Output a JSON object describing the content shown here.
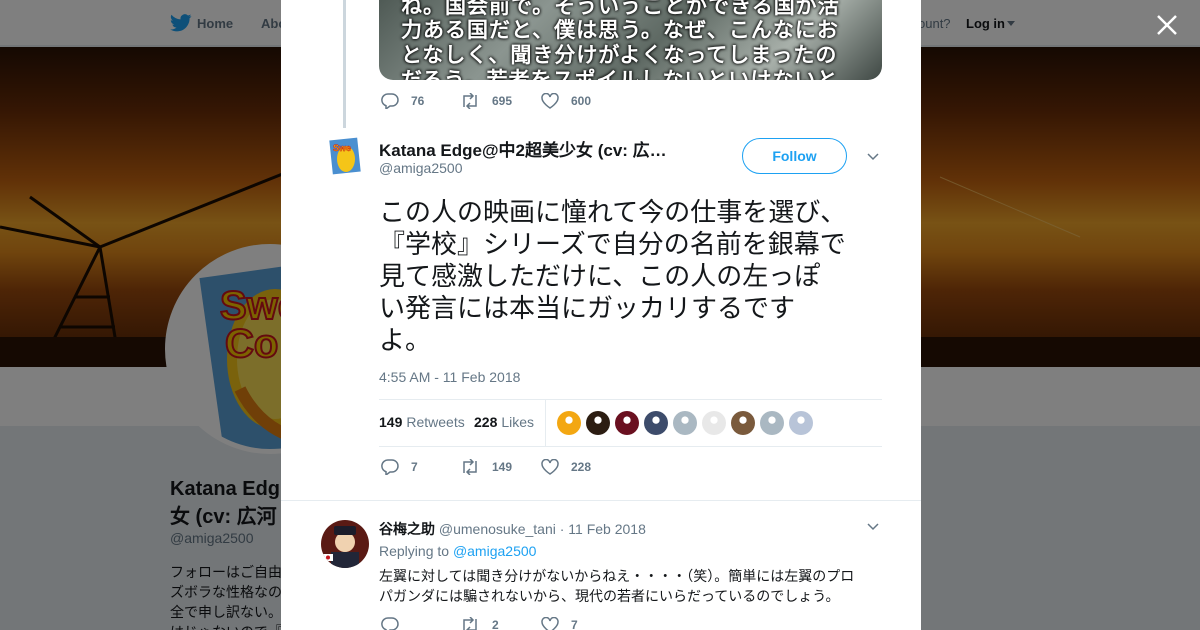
{
  "topnav": {
    "home_label": "Home",
    "about_label": "Abo",
    "account_prompt": "ccount?",
    "login_label": "Log in"
  },
  "profile": {
    "name": "Katana Edg\n女 (cv: 広河",
    "handle": "@amiga2500",
    "bio": "フォローはご自由\nズボラな性格なの\n全で申し訳ない。\nはじゃないので『"
  },
  "quoted_image": {
    "lines": [
      "ね。国会前で。そういうことができる国が活",
      "力ある国だと、僕は思う。なぜ、こんなにお",
      "となしく、聞き分けがよくなってしまったの",
      "だろう。若者をスポイルしないといけないと"
    ]
  },
  "prev_tweet_actions": {
    "replies": "76",
    "retweets": "695",
    "likes": "600"
  },
  "tweet": {
    "author_name": "Katana Edge@中2超美少女 (cv: 広…",
    "author_handle": "@amiga2500",
    "follow_label": "Follow",
    "text_lines": [
      "この人の映画に憧れて今の仕事を選び、",
      "『学校』シリーズで自分の名前を銀幕で",
      "見て感激しただけに、この人の左っぽ",
      "い発言には本当にガッカリするです",
      "よ。"
    ],
    "timestamp": "4:55 AM - 11 Feb 2018",
    "retweets_count": "149",
    "retweets_label": "Retweets",
    "likes_count": "228",
    "likes_label": "Likes",
    "actions": {
      "replies": "7",
      "retweets": "149",
      "likes": "228"
    },
    "likers": [
      "#f3a712",
      "#2c1d12",
      "#6a1020",
      "#3d4c6b",
      "#aab8c2",
      "#e8e8e8",
      "#7a5a3c",
      "#aab8c2",
      "#b8c4d8"
    ]
  },
  "reply": {
    "name": "谷梅之助",
    "handle": "@umenosuke_tani",
    "date": "11 Feb 2018",
    "replying_prefix": "Replying to",
    "replying_to": "@amiga2500",
    "text_line1": "左翼に対しては聞き分けがないからねえ・・・・（笑）。簡単には左翼のプロ",
    "text_line2": "パガンダには騙されないから、現代の若者にいらだっているのでしょう。",
    "actions": {
      "replies": "",
      "retweets": "2",
      "likes": "7"
    }
  },
  "colors": {
    "twitter_blue": "#1da1f2",
    "text_primary": "#14171a",
    "text_secondary": "#657786"
  }
}
